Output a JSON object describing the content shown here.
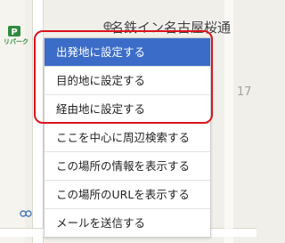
{
  "map": {
    "place_label": "名鉄イン名古屋桜通",
    "number_label": "17",
    "poi_caption": "リパーク"
  },
  "context_menu": {
    "items": [
      {
        "label": "出発地に設定する",
        "selected": true
      },
      {
        "label": "目的地に設定する",
        "selected": false
      },
      {
        "label": "経由地に設定する",
        "selected": false
      },
      {
        "label": "ここを中心に周辺検索する",
        "selected": false
      },
      {
        "label": "この場所の情報を表示する",
        "selected": false
      },
      {
        "label": "この場所のURLを表示する",
        "selected": false
      },
      {
        "label": "メールを送信する",
        "selected": false
      }
    ]
  },
  "colors": {
    "selected_item": "#3b6cc8",
    "annotation_border": "#d9141e",
    "map_background": "#f1efe9"
  }
}
